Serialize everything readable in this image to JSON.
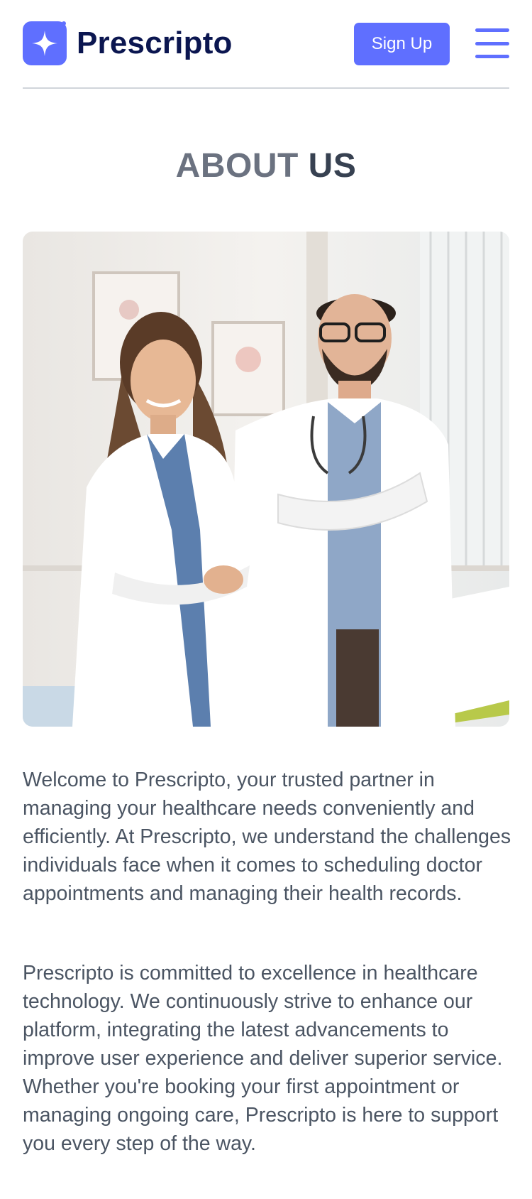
{
  "header": {
    "brand": "Prescripto",
    "signup_label": "Sign Up"
  },
  "about": {
    "title_light": "ABOUT",
    "title_strong": "US",
    "paragraphs": [
      "Welcome to Prescripto, your trusted partner in managing your healthcare needs conveniently and efficiently. At Prescripto, we understand the challenges individuals face when it comes to scheduling doctor appointments and managing their health records.",
      "Prescripto is committed to excellence in healthcare technology. We continuously strive to enhance our platform, integrating the latest advancements to improve user experience and deliver superior service. Whether you're booking your first appointment or managing ongoing care, Prescripto is here to support you every step of the way."
    ]
  },
  "colors": {
    "accent": "#5f6fff",
    "brand_text": "#0b1650",
    "body_text": "#4b5563"
  },
  "icons": {
    "logo": "sparkle-logo-icon",
    "menu": "hamburger-menu-icon"
  }
}
